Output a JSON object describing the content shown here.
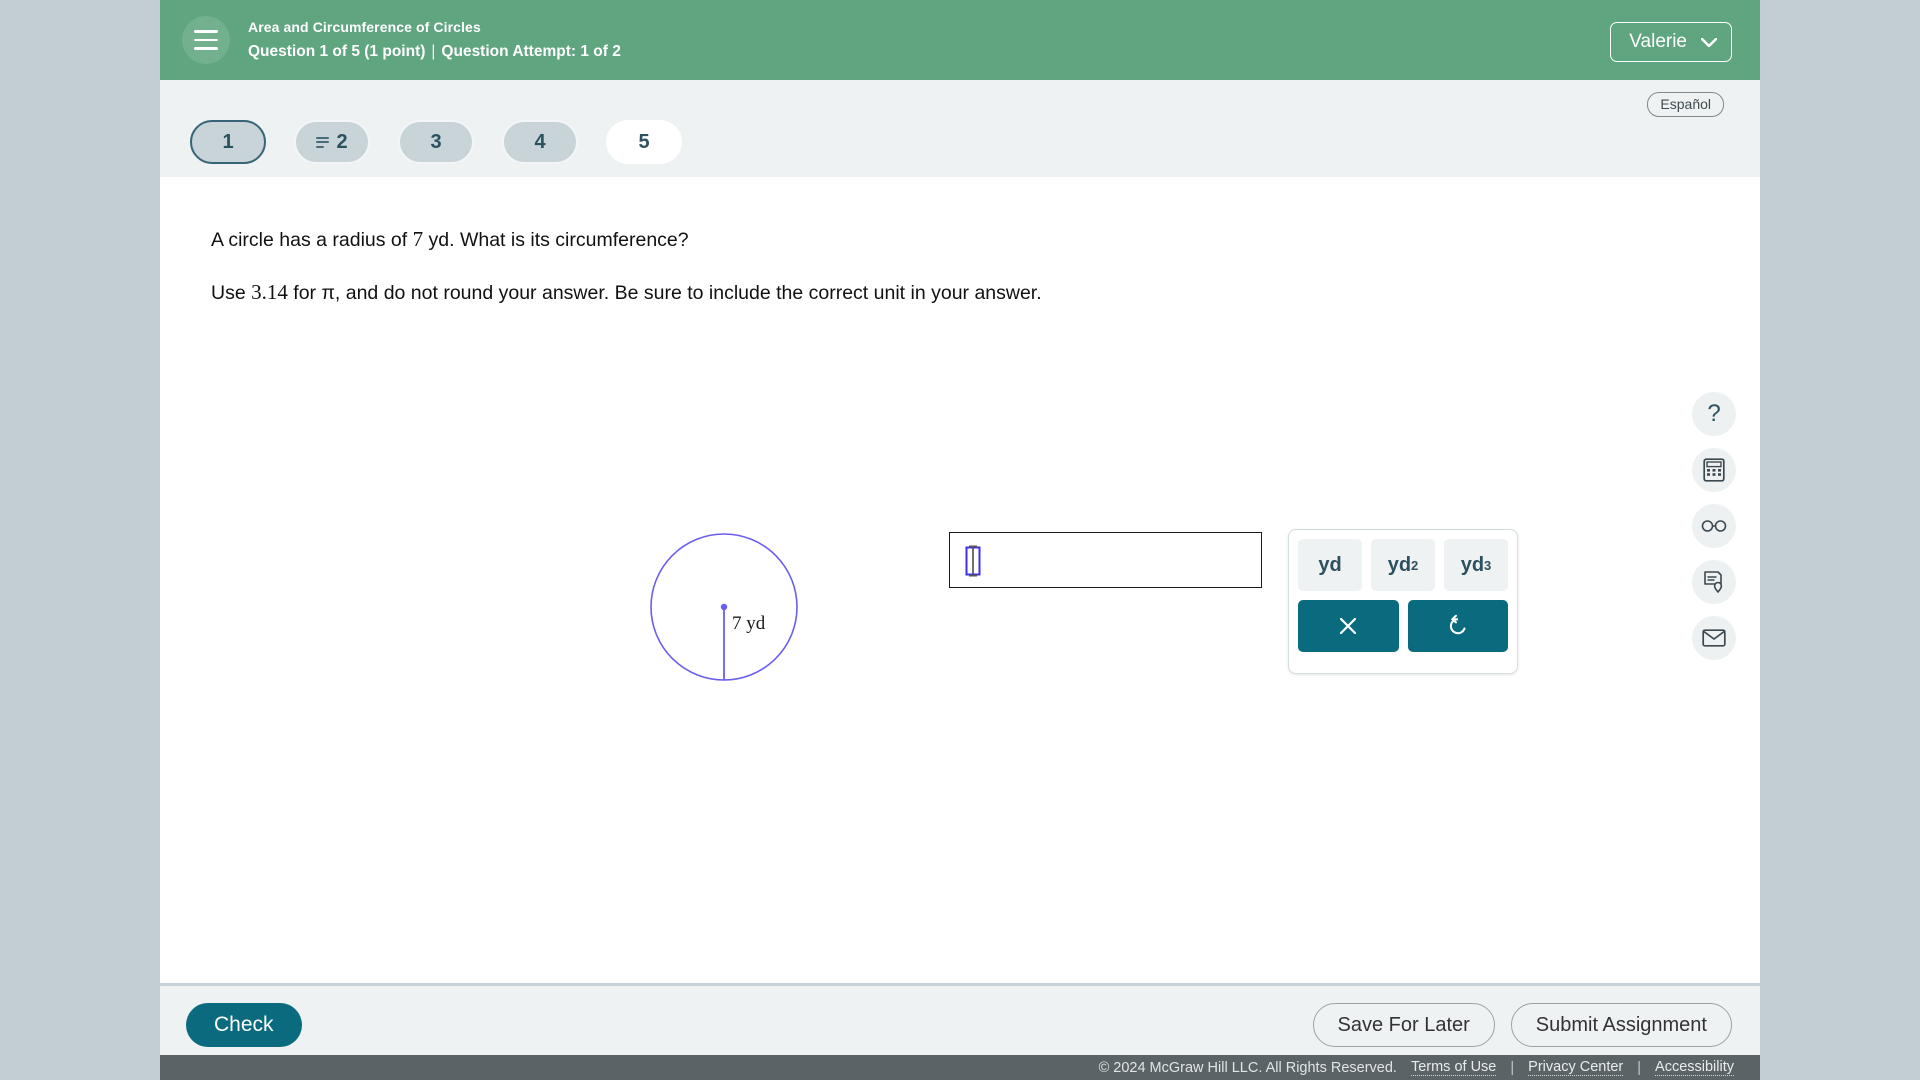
{
  "header": {
    "menu_icon": "hamburger-icon",
    "course_title": "Area and Circumference of Circles",
    "question_progress": "Question 1 of 5 (1 point)",
    "separator": "|",
    "attempt": "Question Attempt: 1 of 2",
    "user_name": "Valerie",
    "user_chevron_icon": "chevron-down-icon",
    "brand_green": "#5fa57f"
  },
  "navstrip": {
    "language_toggle": "Español",
    "pills": [
      {
        "label": "1",
        "state": "current",
        "icon": ""
      },
      {
        "label": "2",
        "state": "answered",
        "icon": "lines-icon"
      },
      {
        "label": "3",
        "state": "answered",
        "icon": ""
      },
      {
        "label": "4",
        "state": "answered",
        "icon": ""
      },
      {
        "label": "5",
        "state": "unseen",
        "icon": ""
      }
    ]
  },
  "question": {
    "line1_a": "A circle has a radius of ",
    "line1_value": "7",
    "line1_b": " yd. What is its circumference?",
    "line2_a": "Use ",
    "line2_value": "3.14",
    "line2_b": " for π, and do not round your answer. Be sure to include the correct unit in your answer.",
    "figure": {
      "name": "circle-diagram",
      "radius_label": "7 yd",
      "stroke_color": "#6a5ef0"
    }
  },
  "answer": {
    "value": "",
    "placeholder": "",
    "cursor_icon": "math-cursor-icon"
  },
  "keypad": {
    "unit_keys": [
      "yd",
      "yd²",
      "yd³"
    ],
    "unit_bases": [
      "yd",
      "yd",
      "yd"
    ],
    "unit_exponents": [
      "",
      "2",
      "3"
    ],
    "clear_label": "×",
    "clear_name": "clear-button",
    "undo_label": "↺",
    "undo_name": "undo-button",
    "action_color": "#0a6b7e"
  },
  "tools": [
    {
      "name": "help-icon",
      "label": "?"
    },
    {
      "name": "calculator-icon",
      "label": ""
    },
    {
      "name": "glasses-icon",
      "label": ""
    },
    {
      "name": "reference-sheet-icon",
      "label": ""
    },
    {
      "name": "mail-icon",
      "label": ""
    }
  ],
  "actions": {
    "check": "Check",
    "save_for_later": "Save For Later",
    "submit_assignment": "Submit Assignment"
  },
  "footer": {
    "copyright": "© 2024 McGraw Hill LLC. All Rights Reserved.",
    "links": [
      "Terms of Use",
      "Privacy Center",
      "Accessibility"
    ],
    "separator": "|"
  }
}
